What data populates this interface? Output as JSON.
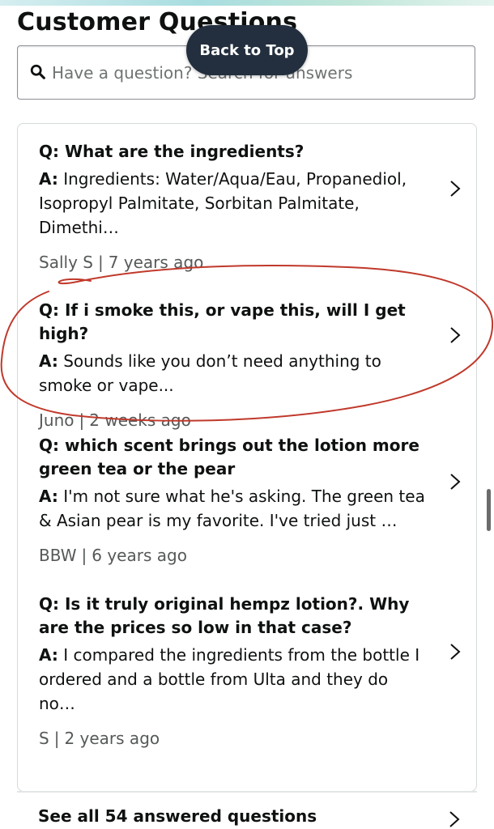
{
  "header": {
    "title": "Customer Questions",
    "back_to_top": "Back to Top"
  },
  "search": {
    "placeholder": "Have a question? Search for answers",
    "value": "",
    "icon": "search-icon"
  },
  "questions": [
    {
      "question": "Q: What are the ingredients?",
      "answer_prefix": "A:",
      "answer": "Ingredients: Water/Aqua/Eau, Propanediol, Isopropyl Palmitate, Sorbitan Palmitate, Dimethi…",
      "author": "Sally S",
      "separator": "|",
      "time": "7 years ago"
    },
    {
      "question": "Q: If i smoke this, or vape this, will I get high?",
      "answer_prefix": "A:",
      "answer": "Sounds like you don’t need anything to smoke or vape...",
      "author": "Juno",
      "separator": "|",
      "time": "2 weeks ago"
    },
    {
      "question": "Q: which scent brings out the lotion more green tea or the pear",
      "answer_prefix": "A:",
      "answer": "I'm not sure what he's asking. The green tea & Asian pear is my favorite. I've tried just …",
      "author": "BBW",
      "separator": "|",
      "time": "6 years ago"
    },
    {
      "question": "Q: Is it truly original hempz lotion?. Why are the prices so low in that case?",
      "answer_prefix": "A:",
      "answer": "I compared the ingredients from the bottle I ordered and a bottle from Ulta and they do no…",
      "author": "S",
      "separator": "|",
      "time": "2 years ago"
    }
  ],
  "footer": {
    "see_all": "See all 54 answered questions"
  },
  "colors": {
    "back_to_top_bg": "#232f3e",
    "annotation_stroke": "#c0392b",
    "meta_text": "#565959"
  }
}
